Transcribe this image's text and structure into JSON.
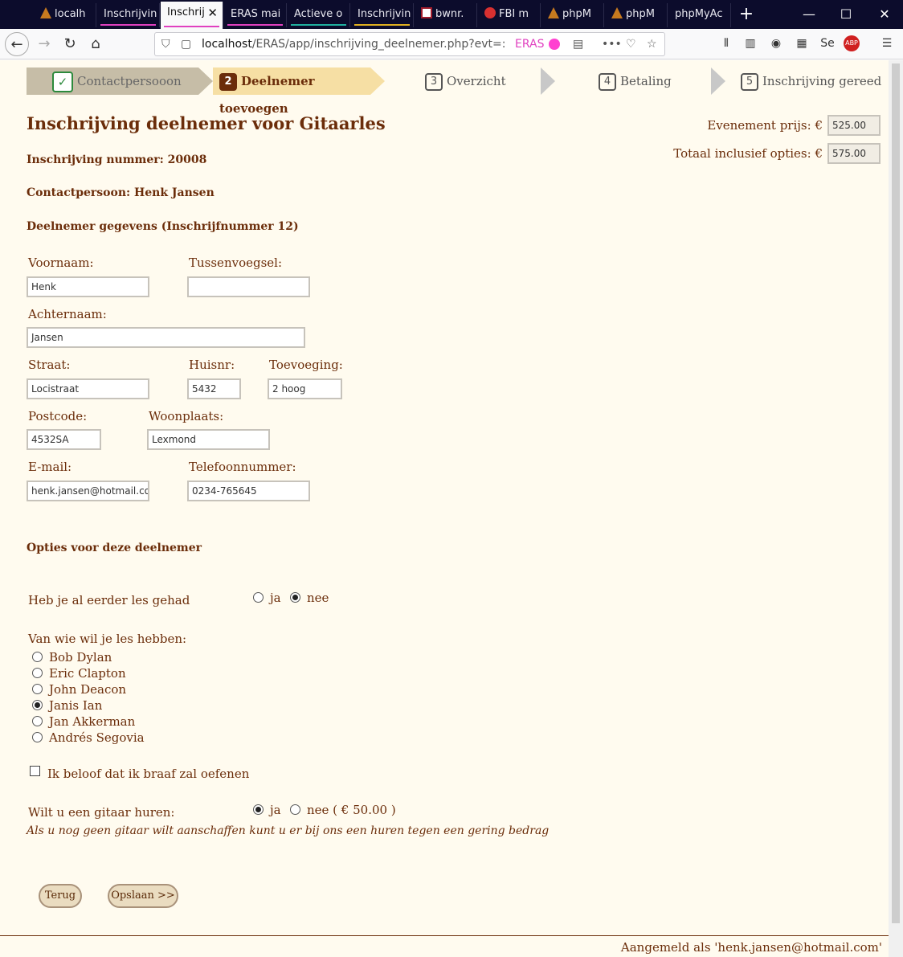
{
  "tabs": [
    {
      "label": "localh",
      "line": ""
    },
    {
      "label": "Inschrijvin",
      "line": "#e040c0"
    },
    {
      "label": "Inschrij",
      "line": "#e040c0",
      "active": true
    },
    {
      "label": "ERAS mai",
      "line": "#e040c0"
    },
    {
      "label": "Actieve o",
      "line": "#20b0a0"
    },
    {
      "label": "Inschrijvin",
      "line": "#e0b020"
    },
    {
      "label": "bwnr.",
      "line": ""
    },
    {
      "label": "FBI m",
      "line": ""
    },
    {
      "label": "phpM",
      "line": ""
    },
    {
      "label": "phpM",
      "line": ""
    },
    {
      "label": "phpMyAc",
      "line": ""
    }
  ],
  "url": {
    "host": "localhost",
    "path": "/ERAS/app/inschrijving_deelnemer.php?evt=:",
    "container": "ERAS"
  },
  "steps": [
    {
      "num": "✓",
      "label": "Contactpersooon"
    },
    {
      "num": "2",
      "label": "Deelnemer toevoegen"
    },
    {
      "num": "3",
      "label": "Overzicht"
    },
    {
      "num": "4",
      "label": "Betaling"
    },
    {
      "num": "5",
      "label": "Inschrijving gereed"
    }
  ],
  "title": "Inschrijving deelnemer voor Gitaarles",
  "price": {
    "event_label": "Evenement prijs: €",
    "event_value": "525.00",
    "total_label": "Totaal inclusief opties: €",
    "total_value": "575.00"
  },
  "registration": "Inschrijving nummer: 20008",
  "contact": "Contactpersoon: Henk Jansen",
  "participant_header": "Deelnemer gegevens (Inschrijfnummer 12)",
  "form": {
    "voornaam": {
      "label": "Voornaam:",
      "value": "Henk"
    },
    "tussenvoegsel": {
      "label": "Tussenvoegsel:",
      "value": ""
    },
    "achternaam": {
      "label": "Achternaam:",
      "value": "Jansen"
    },
    "straat": {
      "label": "Straat:",
      "value": "Locistraat"
    },
    "huisnr": {
      "label": "Huisnr:",
      "value": "5432"
    },
    "toevoeging": {
      "label": "Toevoeging:",
      "value": "2 hoog"
    },
    "postcode": {
      "label": "Postcode:",
      "value": "4532SA"
    },
    "woonplaats": {
      "label": "Woonplaats:",
      "value": "Lexmond"
    },
    "email": {
      "label": "E-mail:",
      "value": "henk.jansen@hotmail.co"
    },
    "telefoon": {
      "label": "Telefoonnummer:",
      "value": "0234-765645"
    }
  },
  "options_header": "Opties voor deze deelnemer",
  "q_les": {
    "label": "Heb je al eerder les gehad",
    "yes": "ja",
    "no": "nee",
    "selected": "nee"
  },
  "q_leraar": {
    "label": "Van wie wil je les hebben:",
    "options": [
      "Bob Dylan",
      "Eric Clapton",
      "John Deacon",
      "Janis Ian",
      "Jan Akkerman",
      "Andrés Segovia"
    ],
    "selected": "Janis Ian"
  },
  "q_oefenen": {
    "label": "Ik beloof dat ik braaf zal oefenen",
    "checked": false
  },
  "q_gitaar": {
    "label": "Wilt u een gitaar huren:",
    "yes": "ja",
    "no": "nee ( € 50.00 )",
    "selected": "ja",
    "note": "Als u nog geen gitaar wilt aanschaffen kunt u er bij ons een huren tegen een gering bedrag"
  },
  "buttons": {
    "back": "Terug",
    "save": "Opslaan >>"
  },
  "footer": "Aangemeld als 'henk.jansen@hotmail.com'"
}
